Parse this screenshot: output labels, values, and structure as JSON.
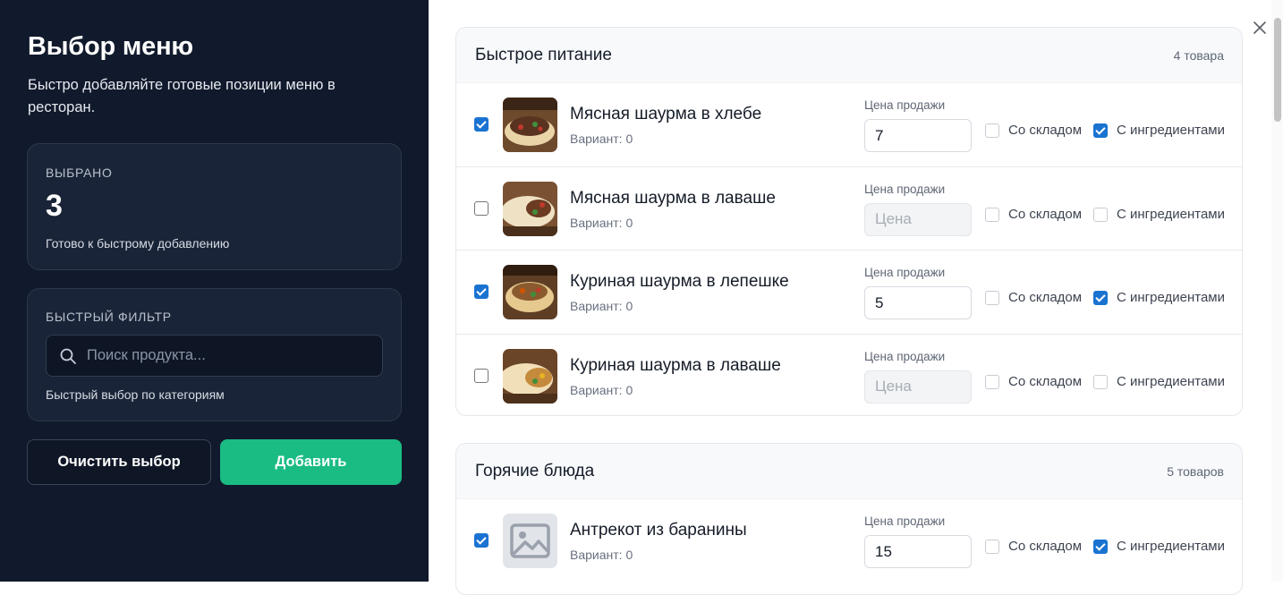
{
  "panel": {
    "title": "Выбор меню",
    "description": "Быстро добавляйте готовые позиции меню в ресторан.",
    "selected_caption": "ВЫБРАНО",
    "selected_count": "3",
    "selected_hint": "Готово к быстрому добавлению",
    "filter_caption": "БЫСТРЫЙ ФИЛЬТР",
    "search_placeholder": "Поиск продукта...",
    "filter_hint": "Быстрый выбор по категориям",
    "clear_label": "Очистить выбор",
    "add_label": "Добавить"
  },
  "colors": {
    "panel_bg": "#111a2c",
    "accent": "#1abc84",
    "checkbox": "#1a73d1"
  },
  "icons": {
    "search": "search-icon",
    "close": "close-icon",
    "image_placeholder": "image-placeholder-icon"
  },
  "sections": [
    {
      "title": "Быстрое питание",
      "count": "4 товара",
      "items": [
        {
          "name": "Мясная шаурма в хлебе",
          "variant": "Вариант: 0",
          "price_label": "Цена продажи",
          "price": "7",
          "price_placeholder": "Цена",
          "selected": true,
          "stock_label": "Со складом",
          "stock": false,
          "ingr_label": "С ингредиентами",
          "ingr": true
        },
        {
          "name": "Мясная шаурма в лаваше",
          "variant": "Вариант: 0",
          "price_label": "Цена продажи",
          "price": "",
          "price_placeholder": "Цена",
          "selected": false,
          "stock_label": "Со складом",
          "stock": false,
          "ingr_label": "С ингредиентами",
          "ingr": false
        },
        {
          "name": "Куриная шаурма в лепешке",
          "variant": "Вариант: 0",
          "price_label": "Цена продажи",
          "price": "5",
          "price_placeholder": "Цена",
          "selected": true,
          "stock_label": "Со складом",
          "stock": false,
          "ingr_label": "С ингредиентами",
          "ingr": true
        },
        {
          "name": "Куриная шаурма в лаваше",
          "variant": "Вариант: 0",
          "price_label": "Цена продажи",
          "price": "",
          "price_placeholder": "Цена",
          "selected": false,
          "stock_label": "Со складом",
          "stock": false,
          "ingr_label": "С ингредиентами",
          "ingr": false
        }
      ]
    },
    {
      "title": "Горячие блюда",
      "count": "5 товаров",
      "items": [
        {
          "name": "Антрекот из баранины",
          "variant": "Вариант: 0",
          "price_label": "Цена продажи",
          "price": "15",
          "price_placeholder": "Цена",
          "selected": true,
          "stock_label": "Со складом",
          "stock": false,
          "ingr_label": "С ингредиентами",
          "ingr": true
        }
      ]
    }
  ]
}
